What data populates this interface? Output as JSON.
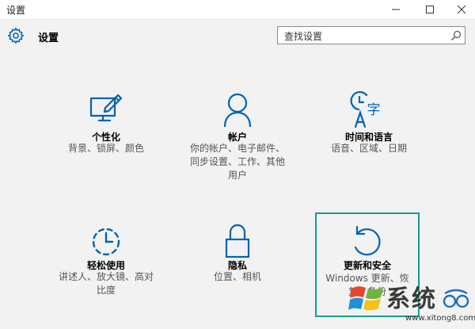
{
  "window": {
    "title": "设置"
  },
  "header": {
    "app_title": "设置",
    "search_placeholder": "查找设置"
  },
  "tiles": [
    {
      "label": "个性化",
      "desc": "背景、锁屏、颜色",
      "icon": "personalization-icon"
    },
    {
      "label": "帐户",
      "desc": "你的帐户、电子邮件、同步设置、工作、其他用户",
      "icon": "account-icon"
    },
    {
      "label": "时间和语言",
      "desc": "语音、区域、日期",
      "icon": "time-language-icon"
    },
    {
      "label": "轻松使用",
      "desc": "讲述人、放大镜、高对比度",
      "icon": "ease-of-access-icon"
    },
    {
      "label": "隐私",
      "desc": "位置、相机",
      "icon": "lock-icon"
    },
    {
      "label": "更新和安全",
      "desc": "Windows 更新、恢复、备份",
      "icon": "update-icon",
      "selected": true
    }
  ],
  "watermark": {
    "brand": "系统",
    "url": "www.xitong8.com"
  },
  "colors": {
    "accent": "#0063b1",
    "selection_border": "#169c8a",
    "background": "#f2f2f2"
  }
}
